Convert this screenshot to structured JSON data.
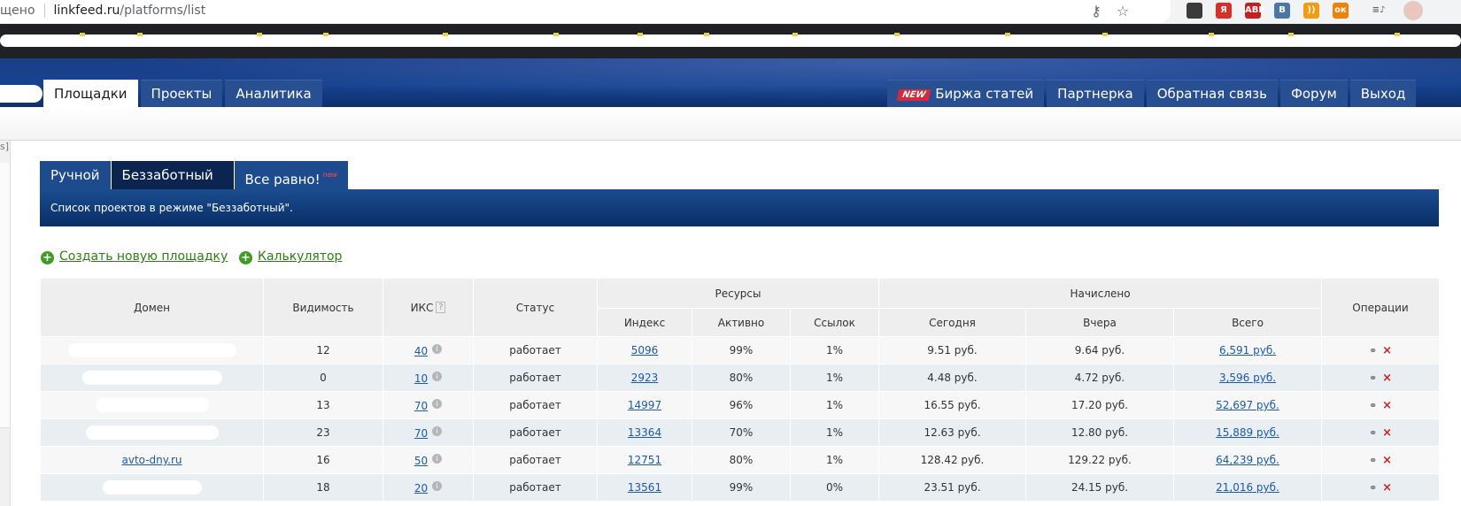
{
  "browser": {
    "address_prefix": "щено",
    "address_host": "linkfeed.ru",
    "address_path": "/platforms/list",
    "icons": [
      "key-icon",
      "star-icon"
    ],
    "extensions": [
      {
        "name": "ext-reader-icon",
        "label": "",
        "color": "#3b3b3b"
      },
      {
        "name": "ext-yandex-icon",
        "label": "Я",
        "color": "#d93025"
      },
      {
        "name": "ext-adblock-icon",
        "label": "ABP",
        "color": "#c71f1f"
      },
      {
        "name": "ext-vk-icon",
        "label": "B",
        "color": "#4a76a8"
      },
      {
        "name": "ext-rss-icon",
        "label": "))",
        "color": "#f39c12"
      },
      {
        "name": "ext-ok-icon",
        "label": "ок",
        "color": "#ee8208"
      },
      {
        "name": "media-icon",
        "label": "≡♪",
        "color": "#5f6368"
      },
      {
        "name": "avatar",
        "label": "",
        "color": "#e9c6c0"
      }
    ]
  },
  "nav": {
    "left": [
      {
        "label": "Площадки",
        "active": true
      },
      {
        "label": "Проекты",
        "active": false
      },
      {
        "label": "Аналитика",
        "active": false
      }
    ],
    "new_badge": "NEW",
    "right": [
      {
        "label": "Биржа статей"
      },
      {
        "label": "Партнерка"
      },
      {
        "label": "Обратная связь"
      },
      {
        "label": "Форум"
      },
      {
        "label": "Выход"
      }
    ]
  },
  "gutter_mark": "s]",
  "tabs": [
    {
      "label": "Ручной"
    },
    {
      "label": "Беззаботный"
    },
    {
      "label": "Все равно!",
      "sup": "new"
    }
  ],
  "banner_text": "Список проектов в режиме \"Беззаботный\".",
  "actions": {
    "create": "Создать новую площадку",
    "calculator": "Калькулятор"
  },
  "table": {
    "headers": {
      "domain": "Домен",
      "visibility": "Видимость",
      "iks": "ИКС",
      "iks_help": "?",
      "status": "Статус",
      "resources": "Ресурсы",
      "index": "Индекс",
      "active": "Активно",
      "links": "Ссылок",
      "accrued": "Начислено",
      "today": "Сегодня",
      "yesterday": "Вчера",
      "total": "Всего",
      "operations": "Операции"
    },
    "rows": [
      {
        "domain": "",
        "visibility": "12",
        "iks": "40",
        "status": "работает",
        "index": "5096",
        "active": "99%",
        "links": "1%",
        "today": "9.51 руб.",
        "yesterday": "9.64 руб.",
        "total": "6,591 руб."
      },
      {
        "domain": "",
        "visibility": "0",
        "iks": "10",
        "status": "работает",
        "index": "2923",
        "active": "80%",
        "links": "1%",
        "today": "4.48 руб.",
        "yesterday": "4.72 руб.",
        "total": "3,596 руб."
      },
      {
        "domain": "",
        "visibility": "13",
        "iks": "70",
        "status": "работает",
        "index": "14997",
        "active": "96%",
        "links": "1%",
        "today": "16.55 руб.",
        "yesterday": "17.20 руб.",
        "total": "52,697 руб."
      },
      {
        "domain": "",
        "visibility": "23",
        "iks": "70",
        "status": "работает",
        "index": "13364",
        "active": "70%",
        "links": "1%",
        "today": "12.63 руб.",
        "yesterday": "12.80 руб.",
        "total": "15,889 руб."
      },
      {
        "domain": "avto-dny.ru",
        "visibility": "16",
        "iks": "50",
        "status": "работает",
        "index": "12751",
        "active": "80%",
        "links": "1%",
        "today": "128.42 руб.",
        "yesterday": "129.22 руб.",
        "total": "64,239 руб."
      },
      {
        "domain": "",
        "visibility": "18",
        "iks": "20",
        "status": "работает",
        "index": "13561",
        "active": "99%",
        "links": "0%",
        "today": "23.51 руб.",
        "yesterday": "24.15 руб.",
        "total": "21,016 руб."
      }
    ]
  }
}
